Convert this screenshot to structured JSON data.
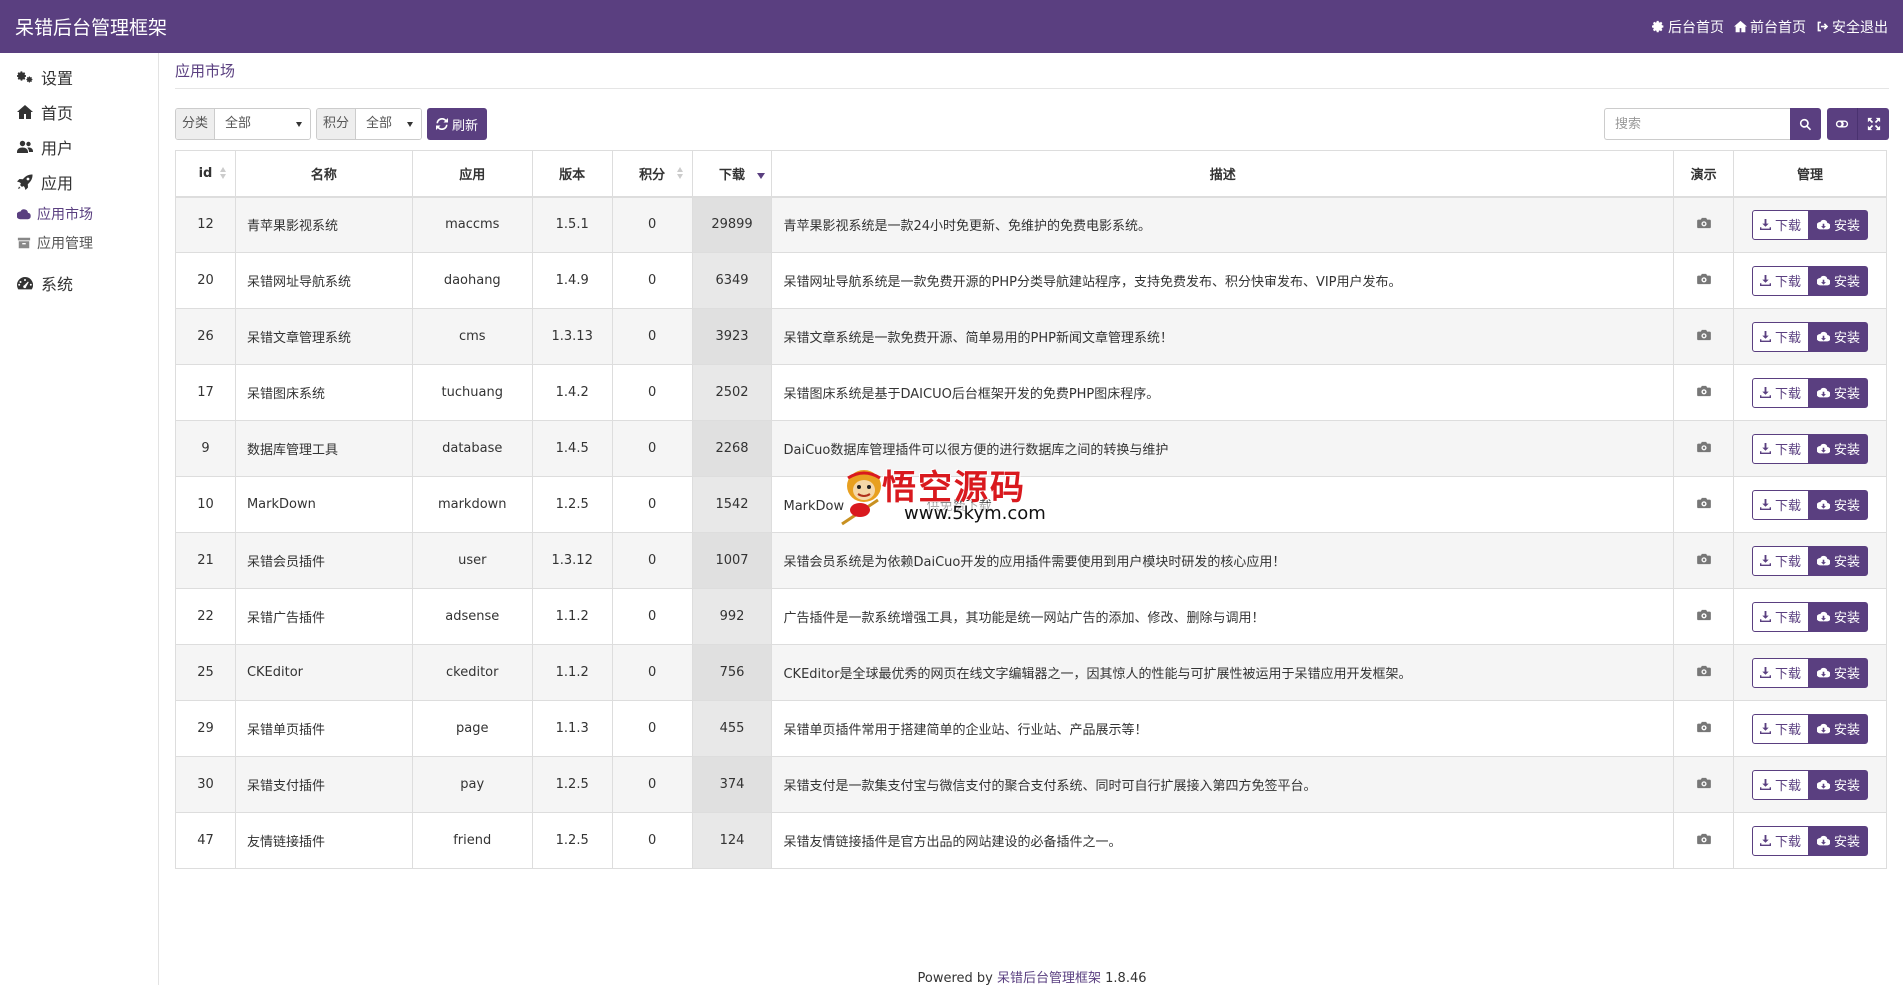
{
  "app": {
    "title": "呆错后台管理框架",
    "accent_color": "#5a3f80"
  },
  "topnav": [
    {
      "label": "后台首页",
      "icon": "gear-icon"
    },
    {
      "label": "前台首页",
      "icon": "home-icon"
    },
    {
      "label": "安全退出",
      "icon": "logout-icon"
    }
  ],
  "sidebar": {
    "items": [
      {
        "label": "设置",
        "icon": "cogs-icon"
      },
      {
        "label": "首页",
        "icon": "home-icon"
      },
      {
        "label": "用户",
        "icon": "users-icon"
      },
      {
        "label": "应用",
        "icon": "rocket-icon"
      },
      {
        "label": "系统",
        "icon": "dashboard-icon"
      }
    ],
    "app_sub": [
      {
        "label": "应用市场",
        "icon": "cloud-icon",
        "active": true
      },
      {
        "label": "应用管理",
        "icon": "archive-icon",
        "active": false
      }
    ]
  },
  "breadcrumb": "应用市场",
  "toolbar": {
    "category_label": "分类",
    "category_value": "全部",
    "points_label": "积分",
    "points_value": "全部",
    "refresh_label": "刷新",
    "search_placeholder": "搜索"
  },
  "table": {
    "headers": [
      "id",
      "名称",
      "应用",
      "版本",
      "积分",
      "下载",
      "描述",
      "演示",
      "管理"
    ],
    "sort_column": "下载",
    "sort_order": "desc",
    "download_label": "下载",
    "install_label": "安装",
    "rows": [
      {
        "id": "12",
        "name": "青苹果影视系统",
        "app": "maccms",
        "version": "1.5.1",
        "points": "0",
        "downloads": "29899",
        "desc": "青苹果影视系统是一款24小时免更新、免维护的免费电影系统。"
      },
      {
        "id": "20",
        "name": "呆错网址导航系统",
        "app": "daohang",
        "version": "1.4.9",
        "points": "0",
        "downloads": "6349",
        "desc": "呆错网址导航系统是一款免费开源的PHP分类导航建站程序，支持免费发布、积分快审发布、VIP用户发布。"
      },
      {
        "id": "26",
        "name": "呆错文章管理系统",
        "app": "cms",
        "version": "1.3.13",
        "points": "0",
        "downloads": "3923",
        "desc": "呆错文章系统是一款免费开源、简单易用的PHP新闻文章管理系统！"
      },
      {
        "id": "17",
        "name": "呆错图床系统",
        "app": "tuchuang",
        "version": "1.4.2",
        "points": "0",
        "downloads": "2502",
        "desc": "呆错图床系统是基于DAICUO后台框架开发的免费PHP图床程序。"
      },
      {
        "id": "9",
        "name": "数据库管理工具",
        "app": "database",
        "version": "1.4.5",
        "points": "0",
        "downloads": "2268",
        "desc": "DaiCuo数据库管理插件可以很方便的进行数据库之间的转换与维护"
      },
      {
        "id": "10",
        "name": "MarkDown",
        "app": "markdown",
        "version": "1.2.5",
        "points": "0",
        "downloads": "1542",
        "desc": "MarkDow                    供免费下载"
      },
      {
        "id": "21",
        "name": "呆错会员插件",
        "app": "user",
        "version": "1.3.12",
        "points": "0",
        "downloads": "1007",
        "desc": "呆错会员系统是为依赖DaiCuo开发的应用插件需要使用到用户模块时研发的核心应用！"
      },
      {
        "id": "22",
        "name": "呆错广告插件",
        "app": "adsense",
        "version": "1.1.2",
        "points": "0",
        "downloads": "992",
        "desc": "广告插件是一款系统增强工具，其功能是统一网站广告的添加、修改、删除与调用！"
      },
      {
        "id": "25",
        "name": "CKEditor",
        "app": "ckeditor",
        "version": "1.1.2",
        "points": "0",
        "downloads": "756",
        "desc": "CKEditor是全球最优秀的网页在线文字编辑器之一，因其惊人的性能与可扩展性被运用于呆错应用开发框架。"
      },
      {
        "id": "29",
        "name": "呆错单页插件",
        "app": "page",
        "version": "1.1.3",
        "points": "0",
        "downloads": "455",
        "desc": "呆错单页插件常用于搭建简单的企业站、行业站、产品展示等！"
      },
      {
        "id": "30",
        "name": "呆错支付插件",
        "app": "pay",
        "version": "1.2.5",
        "points": "0",
        "downloads": "374",
        "desc": "呆错支付是一款集支付宝与微信支付的聚合支付系统、同时可自行扩展接入第四方免签平台。"
      },
      {
        "id": "47",
        "name": "友情链接插件",
        "app": "friend",
        "version": "1.2.5",
        "points": "0",
        "downloads": "124",
        "desc": "呆错友情链接插件是官方出品的网站建设的必备插件之一。"
      }
    ]
  },
  "footer": {
    "prefix": "Powered by",
    "link": "呆错后台管理框架",
    "version": "1.8.46"
  },
  "watermark": {
    "title": "悟空源码",
    "url": "www.5kym.com"
  }
}
